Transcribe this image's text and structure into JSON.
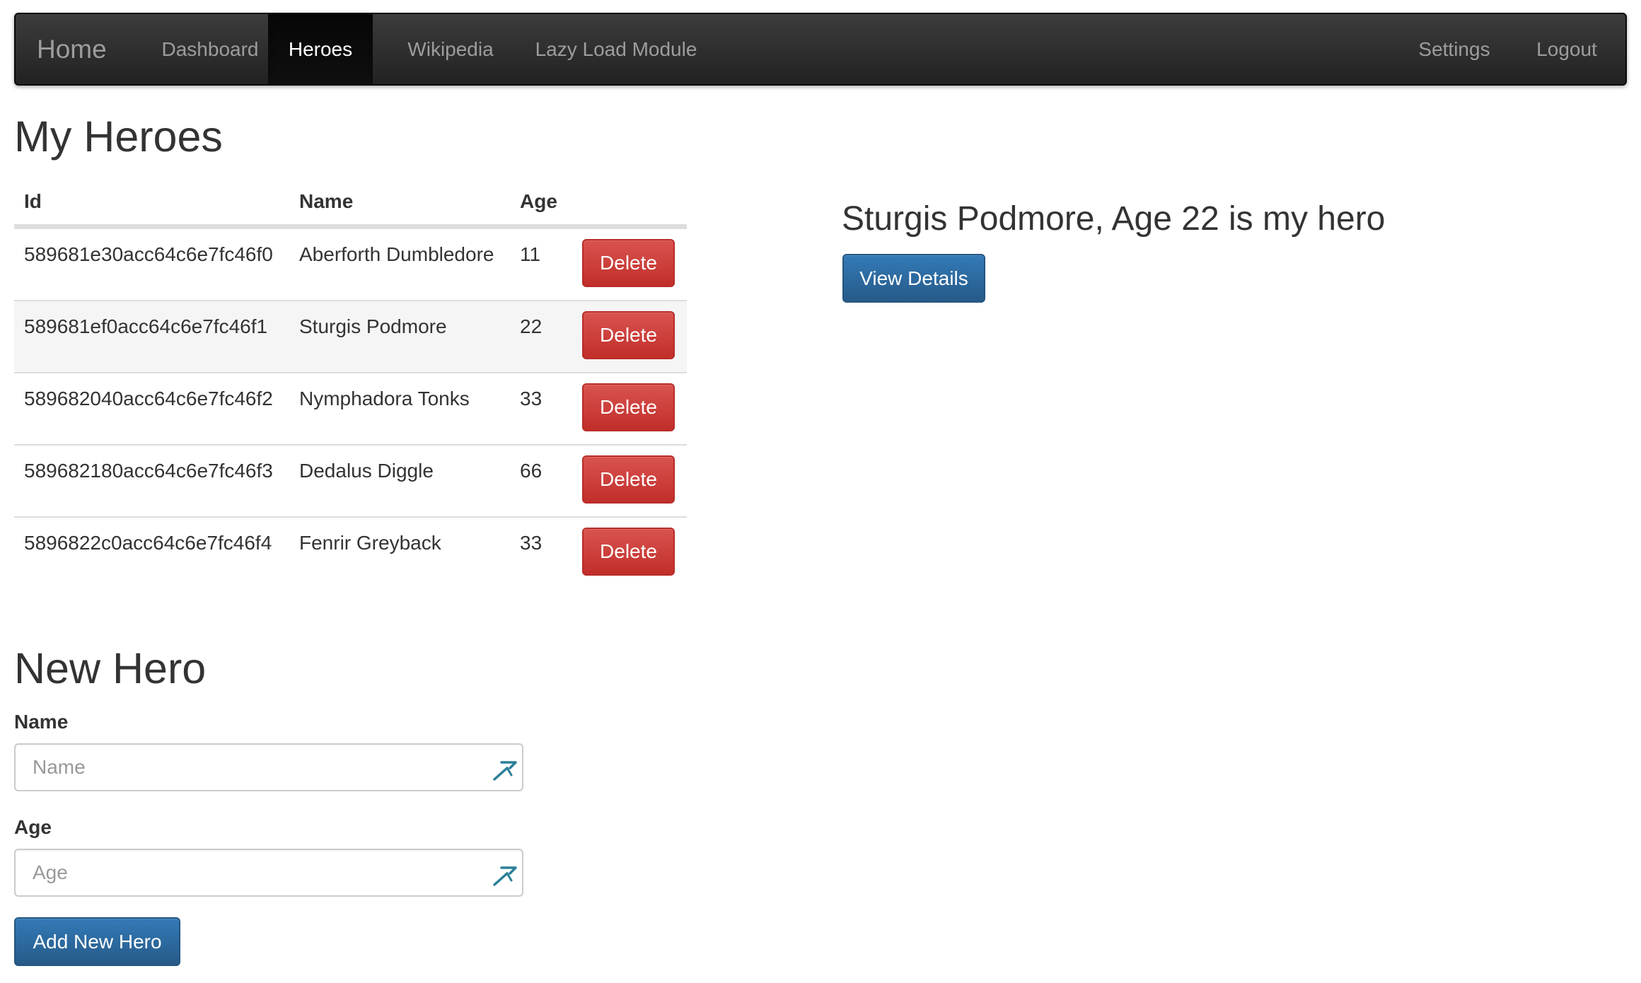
{
  "nav": {
    "brand": "Home",
    "items": [
      {
        "label": "Dashboard"
      },
      {
        "label": "Heroes"
      },
      {
        "label": "Wikipedia"
      },
      {
        "label": "Lazy Load Module"
      }
    ],
    "right_items": [
      {
        "label": "Settings"
      },
      {
        "label": "Logout"
      }
    ]
  },
  "heroes_section": {
    "title": "My Heroes",
    "columns": [
      "Id",
      "Name",
      "Age"
    ],
    "delete_label": "Delete",
    "rows": [
      {
        "id": "589681e30acc64c6e7fc46f0",
        "name": "Aberforth Dumbledore",
        "age": "11"
      },
      {
        "id": "589681ef0acc64c6e7fc46f1",
        "name": "Sturgis Podmore",
        "age": "22"
      },
      {
        "id": "589682040acc64c6e7fc46f2",
        "name": "Nymphadora Tonks",
        "age": "33"
      },
      {
        "id": "589682180acc64c6e7fc46f3",
        "name": "Dedalus Diggle",
        "age": "66"
      },
      {
        "id": "5896822c0acc64c6e7fc46f4",
        "name": "Fenrir Greyback",
        "age": "33"
      }
    ]
  },
  "selected_hero": {
    "message": "Sturgis Podmore, Age 22 is my hero",
    "view_details_label": "View Details"
  },
  "new_hero_form": {
    "title": "New Hero",
    "name_label": "Name",
    "name_placeholder": "Name",
    "age_label": "Age",
    "age_placeholder": "Age",
    "submit_label": "Add New Hero"
  },
  "colors": {
    "navbar": "#222222",
    "delete_button": "#d9534f",
    "primary_button": "#337ab7"
  }
}
